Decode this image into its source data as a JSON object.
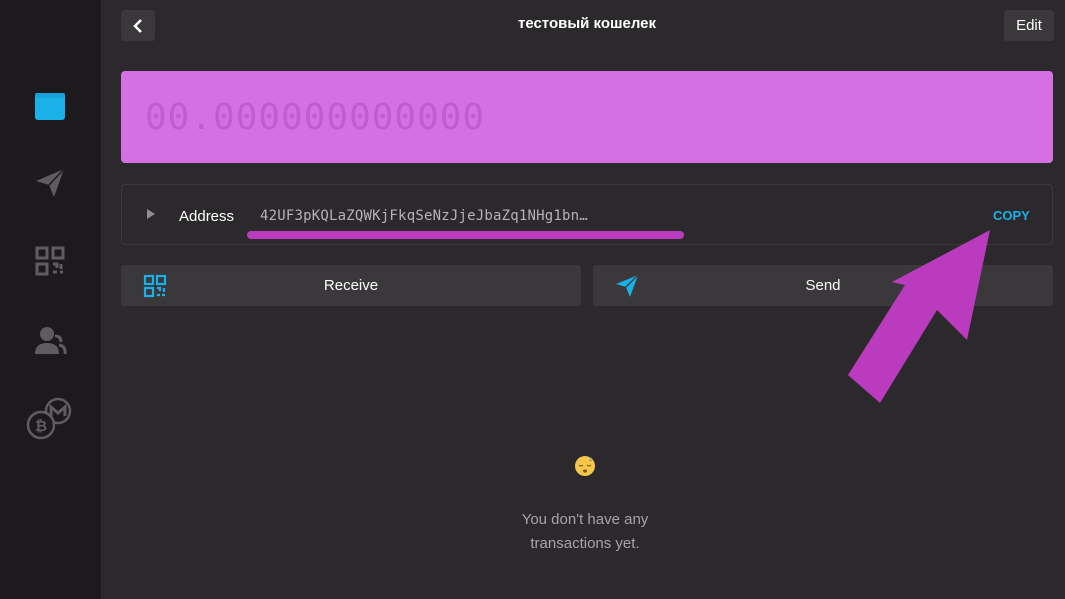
{
  "header": {
    "title": "тестовый кошелек",
    "edit_label": "Edit"
  },
  "sidebar": {
    "items": [
      {
        "icon": "wallet-icon",
        "active": true
      },
      {
        "icon": "send-icon",
        "active": false
      },
      {
        "icon": "qr-code-icon",
        "active": false
      },
      {
        "icon": "contacts-icon",
        "active": false
      },
      {
        "icon": "coins-icon",
        "active": false
      }
    ]
  },
  "balance": {
    "value": "00.000000000000"
  },
  "address": {
    "label": "Address",
    "value": "42UF3pKQLaZQWKjFkqSeNzJjeJbaZq1NHg1bn…",
    "copy_label": "COPY"
  },
  "actions": {
    "receive_label": "Receive",
    "send_label": "Send"
  },
  "empty_state": {
    "line1": "You don't have any",
    "line2": "transactions yet."
  },
  "colors": {
    "balance_bg": "#d470e2",
    "accent": "#1ab0e8",
    "annotation": "#bb3bbe"
  }
}
